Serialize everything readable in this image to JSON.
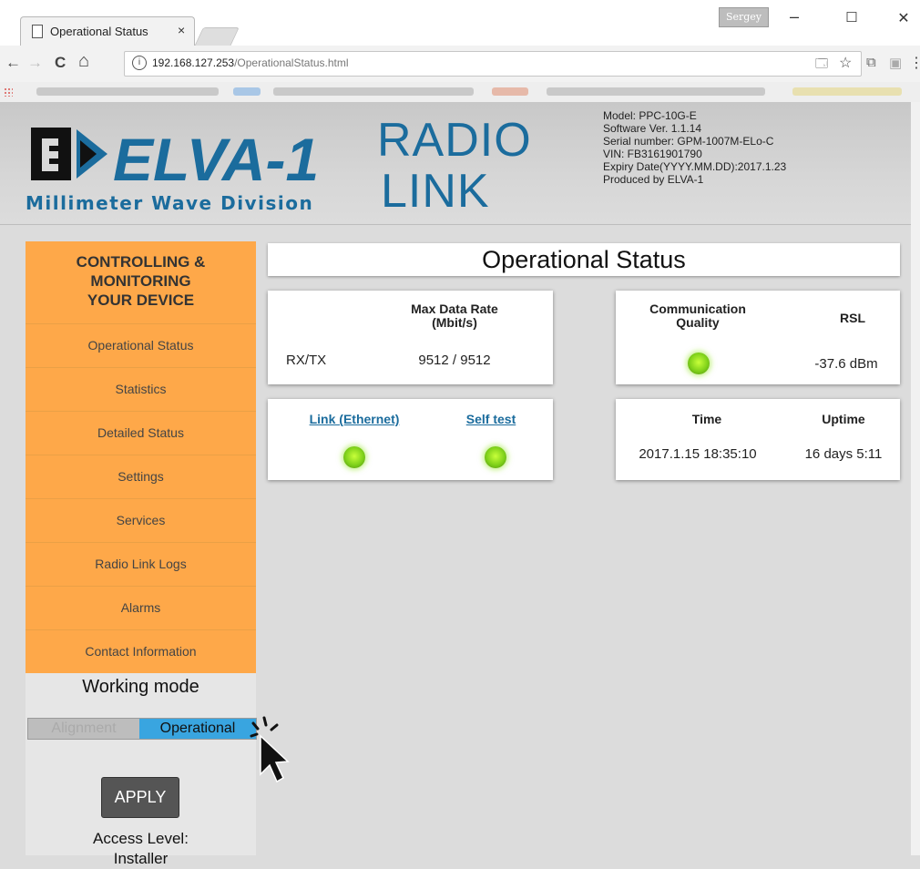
{
  "browser": {
    "tab_title": "Operational Status",
    "tab_close": "×",
    "user_badge": "Sergey",
    "minimize": "–",
    "maximize": "☐",
    "close": "✕",
    "back": "←",
    "forward": "→",
    "reload": "C",
    "home": "⌂",
    "url_host": "192.168.127.253",
    "url_path": "/OperationalStatus.html",
    "star": "☆",
    "more": "⋮",
    "info": "i",
    "translate": "🗔",
    "ext1": "⧉",
    "ext2": "▣"
  },
  "header": {
    "logo_text": "ELVA-1",
    "logo_sub": "Millimeter Wave Division",
    "title_line1": "RADIO",
    "title_line2": "LINK",
    "info": [
      "Model: PPC-10G-E",
      "Software Ver. 1.1.14",
      "Serial number: GPM-1007M-ELo-C",
      "VIN: FB3161901790",
      "Expiry Date(YYYY.MM.DD):2017.1.23",
      "Produced by ELVA-1"
    ]
  },
  "sidebar": {
    "heading_line1": "CONTROLLING &",
    "heading_line2": "MONITORING",
    "heading_line3": "YOUR DEVICE",
    "items": [
      {
        "label": "Operational Status"
      },
      {
        "label": "Statistics"
      },
      {
        "label": "Detailed Status"
      },
      {
        "label": "Settings"
      },
      {
        "label": "Services"
      },
      {
        "label": "Radio Link Logs"
      },
      {
        "label": "Alarms"
      },
      {
        "label": "Contact Information"
      }
    ],
    "working_mode_title": "Working mode",
    "mode_alignment": "Alignment",
    "mode_operational": "Operational",
    "apply": "APPLY",
    "access_line1": "Access Level:",
    "access_line2": "Installer"
  },
  "main": {
    "title": "Operational Status",
    "rate_header_line1": "Max Data Rate",
    "rate_header_line2": "(Mbit/s)",
    "rate_label": "RX/TX",
    "rate_value": "9512 / 9512",
    "comm_quality_line1": "Communication",
    "comm_quality_line2": "Quality",
    "rsl_label": "RSL",
    "rsl_value": "-37.6 dBm",
    "link_label": "Link (Ethernet)",
    "selftest_label": "Self test",
    "time_label": "Time",
    "uptime_label": "Uptime",
    "time_value": "2017.1.15 18:35:10",
    "uptime_value": "16 days 5:11",
    "led_color": "#7fd11a"
  },
  "colors": {
    "menu_orange": "#fea849",
    "accent_blue": "#1b6c9d",
    "toggle_blue": "#39a5e0"
  }
}
